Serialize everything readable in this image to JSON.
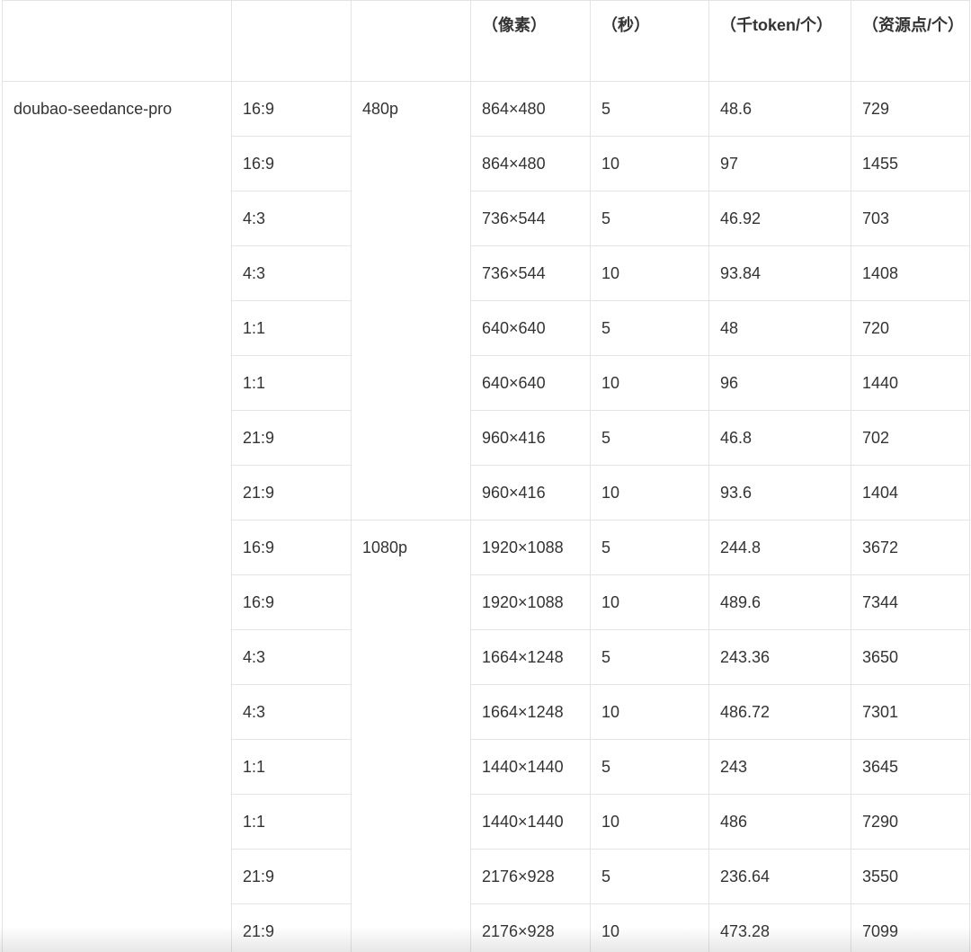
{
  "headers": [
    "",
    "",
    "",
    "（像素）",
    "（秒）",
    "（千token/个）",
    "（资源点/个）"
  ],
  "model": "doubao-seedance-pro",
  "groups": [
    {
      "resolution": "480p",
      "rows": [
        {
          "ratio": "16:9",
          "pixels": "864×480",
          "seconds": "5",
          "ktokens": "48.6",
          "points": "729"
        },
        {
          "ratio": "16:9",
          "pixels": "864×480",
          "seconds": "10",
          "ktokens": "97",
          "points": "1455"
        },
        {
          "ratio": "4:3",
          "pixels": "736×544",
          "seconds": "5",
          "ktokens": "46.92",
          "points": "703"
        },
        {
          "ratio": "4:3",
          "pixels": "736×544",
          "seconds": "10",
          "ktokens": "93.84",
          "points": "1408"
        },
        {
          "ratio": "1:1",
          "pixels": "640×640",
          "seconds": "5",
          "ktokens": "48",
          "points": "720"
        },
        {
          "ratio": "1:1",
          "pixels": "640×640",
          "seconds": "10",
          "ktokens": "96",
          "points": "1440"
        },
        {
          "ratio": "21:9",
          "pixels": "960×416",
          "seconds": "5",
          "ktokens": "46.8",
          "points": "702"
        },
        {
          "ratio": "21:9",
          "pixels": "960×416",
          "seconds": "10",
          "ktokens": "93.6",
          "points": "1404"
        }
      ]
    },
    {
      "resolution": "1080p",
      "rows": [
        {
          "ratio": "16:9",
          "pixels": "1920×1088",
          "seconds": "5",
          "ktokens": "244.8",
          "points": "3672"
        },
        {
          "ratio": "16:9",
          "pixels": "1920×1088",
          "seconds": "10",
          "ktokens": "489.6",
          "points": "7344"
        },
        {
          "ratio": "4:3",
          "pixels": "1664×1248",
          "seconds": "5",
          "ktokens": "243.36",
          "points": "3650"
        },
        {
          "ratio": "4:3",
          "pixels": "1664×1248",
          "seconds": "10",
          "ktokens": "486.72",
          "points": "7301"
        },
        {
          "ratio": "1:1",
          "pixels": "1440×1440",
          "seconds": "5",
          "ktokens": "243",
          "points": "3645"
        },
        {
          "ratio": "1:1",
          "pixels": "1440×1440",
          "seconds": "10",
          "ktokens": "486",
          "points": "7290"
        },
        {
          "ratio": "21:9",
          "pixels": "2176×928",
          "seconds": "5",
          "ktokens": "236.64",
          "points": "3550"
        },
        {
          "ratio": "21:9",
          "pixels": "2176×928",
          "seconds": "10",
          "ktokens": "473.28",
          "points": "7099"
        }
      ]
    }
  ]
}
